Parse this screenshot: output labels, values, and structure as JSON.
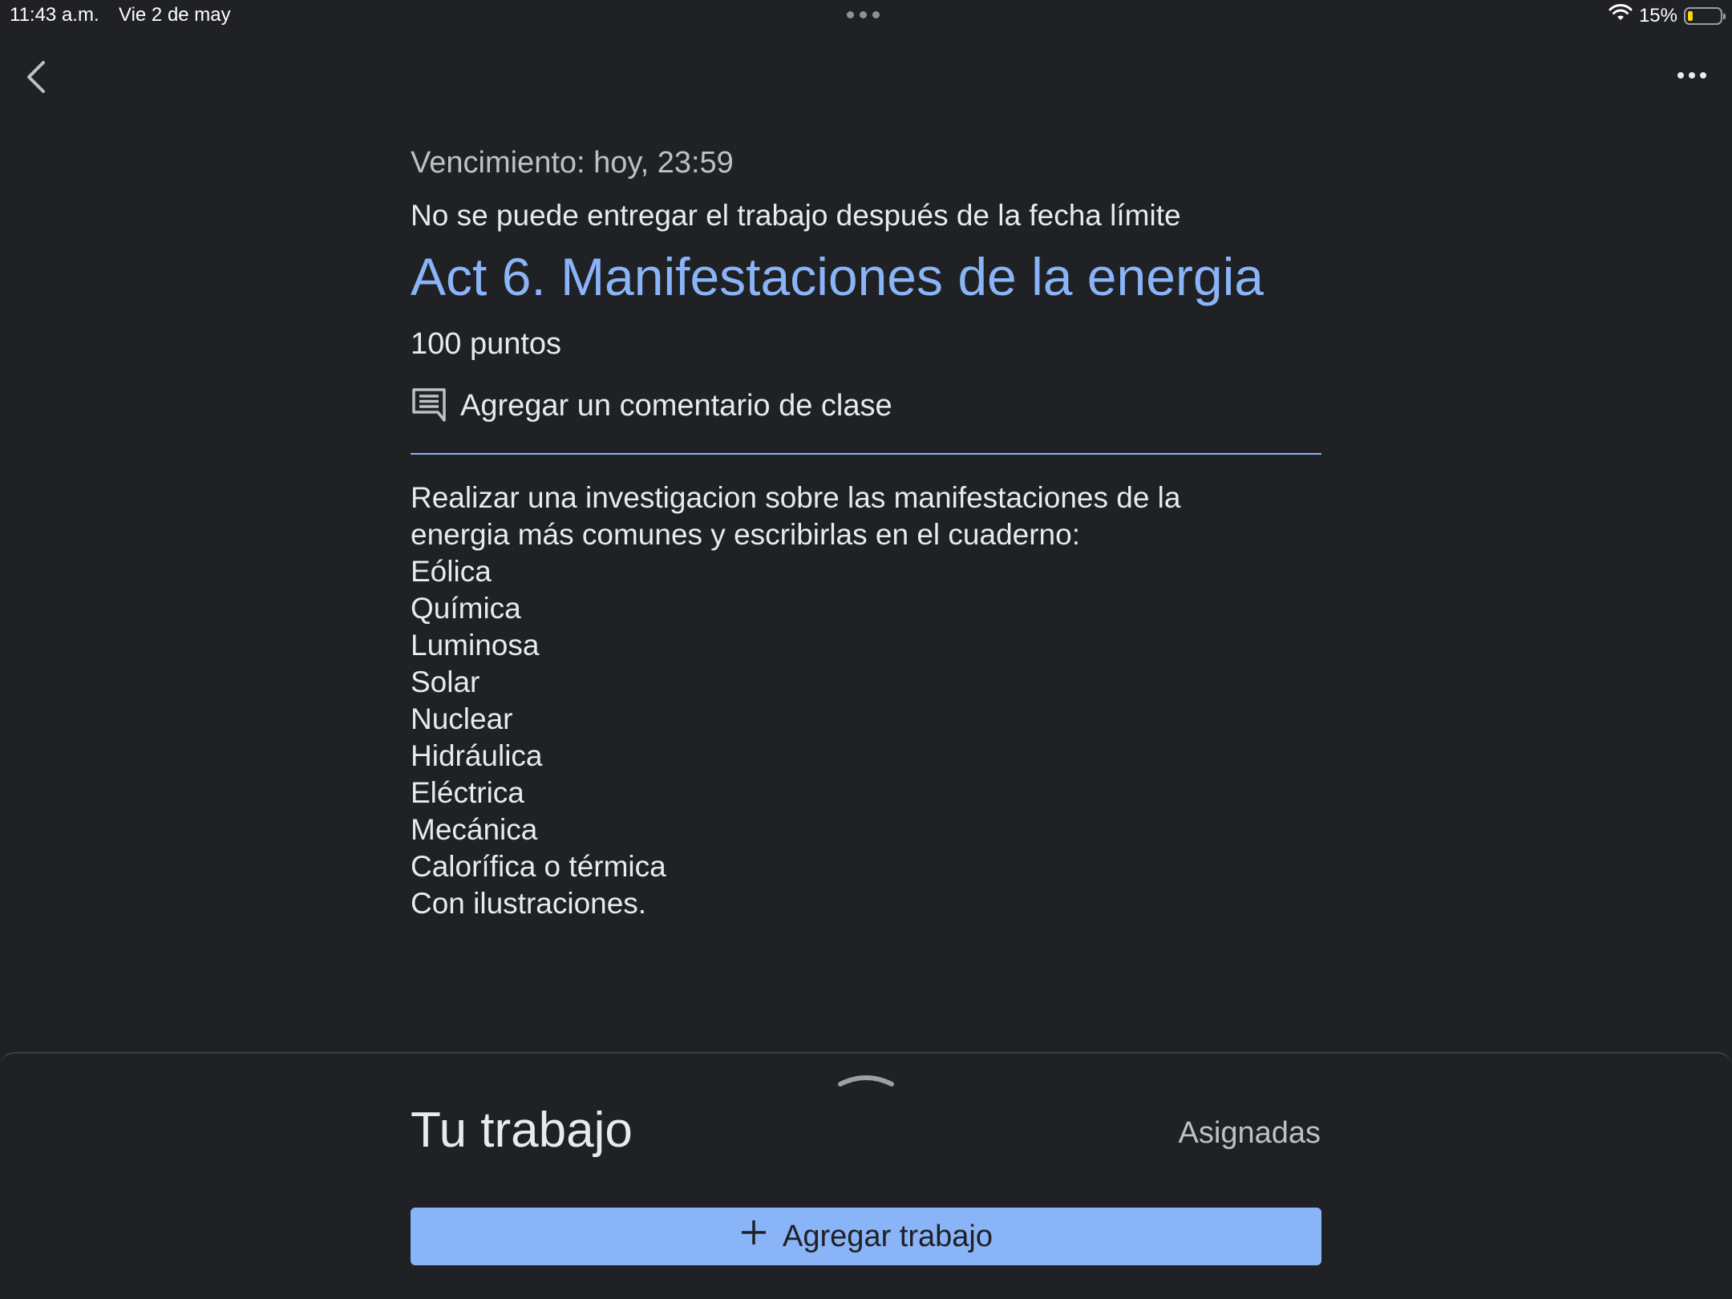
{
  "status_bar": {
    "time": "11:43 a.m.",
    "date": "Vie 2 de may",
    "battery_percent": "15%",
    "battery_level": 0.15,
    "battery_color": "#ffd60a"
  },
  "nav": {
    "back_icon": "chevron-left-icon",
    "more_icon": "more-horizontal-icon"
  },
  "assignment": {
    "due": "Vencimiento: hoy, 23:59",
    "late_notice": "No se puede entregar el trabajo después de la fecha límite",
    "title": "Act 6. Manifestaciones de la energia",
    "points": "100 puntos",
    "class_comment_label": "Agregar un comentario de clase",
    "description_lines": [
      "Realizar una investigacion sobre las manifestaciones de la",
      "energia más comunes y escribirlas en el cuaderno:",
      "Eólica",
      "Química",
      "Luminosa",
      "Solar",
      "Nuclear",
      "Hidráulica",
      "Eléctrica",
      "Mecánica",
      "Calorífica o térmica",
      "Con ilustraciones."
    ]
  },
  "your_work": {
    "title": "Tu trabajo",
    "status": "Asignadas",
    "add_button_label": "Agregar trabajo"
  },
  "colors": {
    "background": "#202124",
    "accent": "#8ab4f8",
    "text": "#e8eaed",
    "secondary_text": "#bdc1c6"
  }
}
